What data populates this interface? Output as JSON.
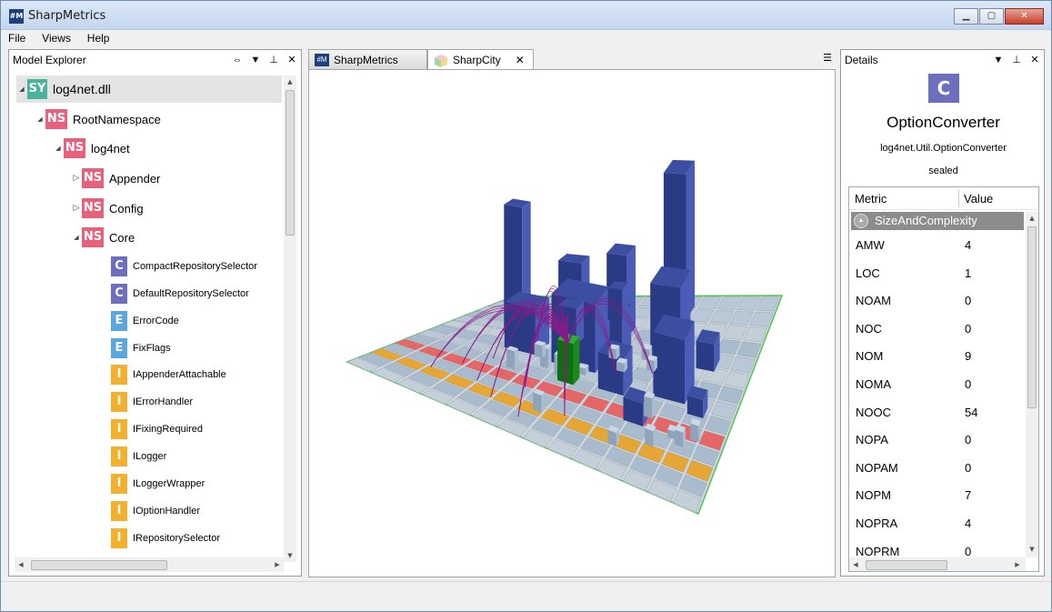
{
  "window": {
    "title": "SharpMetrics",
    "icon_text": "#M"
  },
  "menu": [
    "File",
    "Views",
    "Help"
  ],
  "explorer": {
    "title": "Model Explorer",
    "tree": [
      {
        "badge": "SY",
        "label": "log4net.dll",
        "kind": "sy"
      },
      {
        "badge": "NS",
        "label": "RootNamespace",
        "kind": "ns"
      },
      {
        "badge": "NS",
        "label": "log4net",
        "kind": "ns"
      },
      {
        "badge": "NS",
        "label": "Appender",
        "kind": "ns"
      },
      {
        "badge": "NS",
        "label": "Config",
        "kind": "ns"
      },
      {
        "badge": "NS",
        "label": "Core",
        "kind": "ns"
      },
      {
        "badge": "C",
        "label": "CompactRepositorySelector",
        "kind": "c"
      },
      {
        "badge": "C",
        "label": "DefaultRepositorySelector",
        "kind": "c"
      },
      {
        "badge": "E",
        "label": "ErrorCode",
        "kind": "e"
      },
      {
        "badge": "E",
        "label": "FixFlags",
        "kind": "e"
      },
      {
        "badge": "I",
        "label": "IAppenderAttachable",
        "kind": "i"
      },
      {
        "badge": "I",
        "label": "IErrorHandler",
        "kind": "i"
      },
      {
        "badge": "I",
        "label": "IFixingRequired",
        "kind": "i"
      },
      {
        "badge": "I",
        "label": "ILogger",
        "kind": "i"
      },
      {
        "badge": "I",
        "label": "ILoggerWrapper",
        "kind": "i"
      },
      {
        "badge": "I",
        "label": "IOptionHandler",
        "kind": "i"
      },
      {
        "badge": "I",
        "label": "IRepositorySelector",
        "kind": "i"
      }
    ]
  },
  "tabs": [
    {
      "label": "SharpMetrics",
      "icon": "sharpmetrics-icon"
    },
    {
      "label": "SharpCity",
      "icon": "city-cube-icon",
      "close": "✕"
    }
  ],
  "details": {
    "title": "Details",
    "icon_letter": "C",
    "name": "OptionConverter",
    "full_name": "log4net.Util.OptionConverter",
    "modifier": "sealed",
    "col_metric": "Metric",
    "col_value": "Value",
    "group": "SizeAndComplexity",
    "metrics": [
      {
        "name": "AMW",
        "value": "4"
      },
      {
        "name": "LOC",
        "value": "1"
      },
      {
        "name": "NOAM",
        "value": "0"
      },
      {
        "name": "NOC",
        "value": "0"
      },
      {
        "name": "NOM",
        "value": "9"
      },
      {
        "name": "NOMA",
        "value": "0"
      },
      {
        "name": "NOOC",
        "value": "54"
      },
      {
        "name": "NOPA",
        "value": "0"
      },
      {
        "name": "NOPAM",
        "value": "0"
      },
      {
        "name": "NOPM",
        "value": "7"
      },
      {
        "name": "NOPRA",
        "value": "4"
      },
      {
        "name": "NOPRM",
        "value": "0"
      }
    ]
  },
  "colors": {
    "namespace": "#e6617b",
    "system": "#4bb39d",
    "class": "#6b6fbd",
    "enum": "#5aa7e0",
    "interface": "#f2b02c",
    "selected_building": "#1a8a1a",
    "arc": "#8a1a8a"
  }
}
